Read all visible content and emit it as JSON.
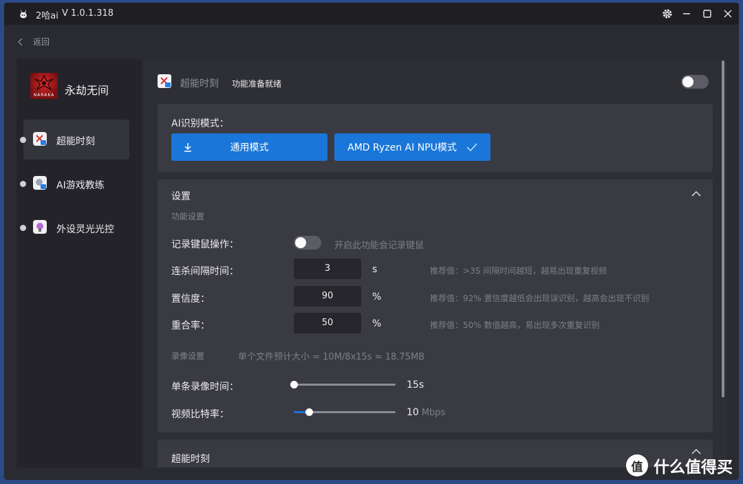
{
  "titlebar": {
    "app_name": "2哈ai",
    "version": "V 1.0.1.318",
    "icons": [
      "gear-icon",
      "minimize-icon",
      "maximize-icon",
      "close-icon"
    ]
  },
  "nav": {
    "back_label": "返回"
  },
  "sidebar": {
    "game_title": "永劫无间",
    "game_logo_text": "NARAKA",
    "items": [
      {
        "label": "超能时刻",
        "active": true
      },
      {
        "label": "AI游戏教练",
        "active": false
      },
      {
        "label": "外设灵光光控",
        "active": false
      }
    ]
  },
  "feature": {
    "title": "超能时刻",
    "status": "功能准备就绪",
    "enabled": false
  },
  "ai_mode": {
    "label": "AI识别模式：",
    "buttons": [
      {
        "label": "通用模式",
        "icon": "download-icon"
      },
      {
        "label": "AMD Ryzen AI NPU模式",
        "icon": "check-icon",
        "selected": true
      }
    ]
  },
  "settings": {
    "title": "设置",
    "function_section": "功能设置",
    "record_input": {
      "label": "记录键鼠操作：",
      "enabled": false,
      "hint": "开启此功能会记录键鼠"
    },
    "rows": [
      {
        "label": "连杀间隔时间：",
        "value": "3",
        "unit": "s",
        "hint": "推荐值：>3S 间隔时间越短，越易出现重复视频"
      },
      {
        "label": "置信度：",
        "value": "90",
        "unit": "%",
        "hint": "推荐值：92% 置信度越低会出现误识别，越高会出现不识别"
      },
      {
        "label": "重合率：",
        "value": "50",
        "unit": "%",
        "hint": "推荐值：50% 数值越高，易出现多次重复识别"
      }
    ],
    "record_section": "录像设置",
    "record_size_note": "单个文件预计大小 ≈ 10M/8x15s ≈ 18.75MB",
    "sliders": [
      {
        "label": "单条录像时间：",
        "value": "15s",
        "unit": "",
        "level": 0
      },
      {
        "label": "视频比特率：",
        "value": "10",
        "unit": "Mbps",
        "level": 0.15
      }
    ]
  },
  "bottom_section": {
    "title": "超能时刻"
  },
  "watermark": {
    "logo": "值",
    "text": "什么值得买"
  },
  "colors": {
    "accent": "#1a76d8",
    "window_bg": "#2a2a31",
    "card_bg": "#3a3a42"
  }
}
